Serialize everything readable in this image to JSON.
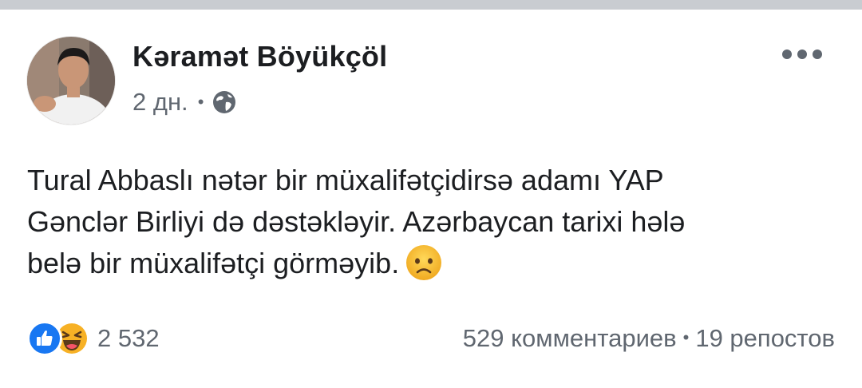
{
  "post": {
    "author": "Kəramət Böyükçöl",
    "time": "2 дн.",
    "meta_separator": "•",
    "privacy_icon": "globe-icon",
    "more_icon": "more-options-icon",
    "text_lines": [
      "Tural Abbaslı nətər bir müxalifətçidirsə adamı YAP",
      "Gənclər Birliyi də dəstəkləyir. Azərbaycan tarixi hələ",
      "belə bir müxalifətçi görməyib."
    ],
    "emoji": "sad-face-emoji"
  },
  "footer": {
    "reaction_icons": [
      "like-icon",
      "haha-icon"
    ],
    "reaction_count": "2 532",
    "comments": "529 комментариев",
    "separator": "•",
    "shares": "19 репостов"
  },
  "colors": {
    "text": "#1c1e21",
    "secondary": "#606770",
    "like_blue": "#1877f2",
    "emoji_yellow": "#f7b125"
  }
}
